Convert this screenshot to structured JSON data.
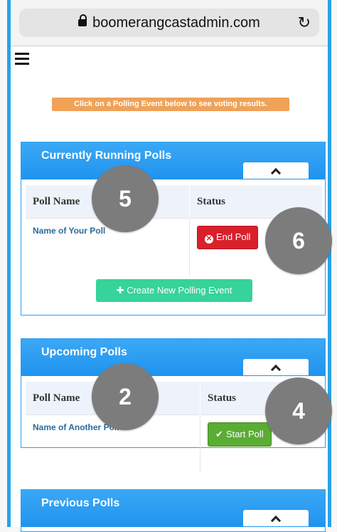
{
  "browser": {
    "url": "boomerangcastadmin.com"
  },
  "notice": "Click on a Polling Event below to see voting results.",
  "running": {
    "title": "Currently Running Polls",
    "col_name": "Poll Name",
    "col_status": "Status",
    "poll_name": "Name of Your Poll",
    "action_label": "End Poll",
    "create_label": "Create New Polling Event"
  },
  "upcoming": {
    "title": "Upcoming Polls",
    "col_name": "Poll Name",
    "col_status": "Status",
    "poll_name": "Name of Another Poll",
    "action_label": "Start Poll"
  },
  "previous": {
    "title": "Previous Polls"
  },
  "markers": {
    "m5": "5",
    "m6": "6",
    "m2": "2",
    "m4": "4"
  }
}
